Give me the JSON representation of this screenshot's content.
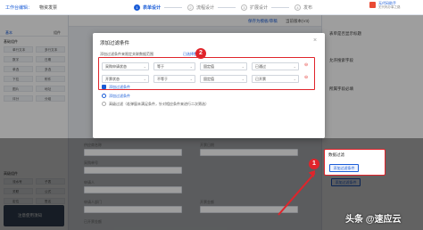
{
  "topbar": {
    "back_label": "工作台编辑：",
    "app_name": "物资发票",
    "steps": [
      {
        "num": "1",
        "label": "表单设计",
        "active": true
      },
      {
        "num": "2",
        "label": "流程设计",
        "active": false
      },
      {
        "num": "3",
        "label": "扩展设计",
        "active": false
      },
      {
        "num": "4",
        "label": "发布",
        "active": false
      }
    ],
    "user_name": "无代码助手",
    "user_sub": "无代码办事之路",
    "save_label": "保存",
    "next_label": "下一步",
    "sub_link": "保存为模板/草稿",
    "version_label": "当前版本(V3)"
  },
  "sidebar": {
    "tabs": [
      "基本",
      "",
      "组件"
    ],
    "groups": [
      {
        "title": "基础组件",
        "items": [
          "单行文本",
          "多行文本",
          "数字",
          "日期",
          "单选",
          "多选",
          "下拉",
          "附件",
          "图片",
          "地址",
          "评分",
          "分组"
        ]
      },
      {
        "title": "高级组件",
        "items": [
          "流水号",
          "子表",
          "关联",
          "公式",
          "定位",
          "签名"
        ]
      }
    ],
    "banner": "注意使用须知"
  },
  "right_panel": {
    "items": [
      "表单是否显示标题",
      "允许搜索字段",
      "所属字段必填",
      "数据过滤",
      "添加过滤条件"
    ],
    "filter_section_title": "数据过滤",
    "filter_button": "添加过滤条件",
    "colors": {
      "primary": "#1a5cd7",
      "danger": "#e53935"
    }
  },
  "dialog": {
    "title": "添加过滤条件",
    "hint": "添加过滤条件来限定关联数据范围",
    "link_text": "已选择数据表",
    "rows": [
      {
        "field": "采购申请状态",
        "op": "等于",
        "kind": "固定值",
        "value": "已通过"
      },
      {
        "field": "开票状态",
        "op": "不等于",
        "kind": "固定值",
        "value": "已开票"
      }
    ],
    "add_condition": "添加过滤条件",
    "option1_label": "添加过滤条件",
    "option2_label": "高级过滤（若弹窗未满足条件，针对相应条件来进行二次筛选）"
  },
  "form": {
    "labels": [
      "供应商编号",
      "供应商名称",
      "开票日期",
      "采购单号",
      "申请人",
      "申请人部门",
      "开票金额",
      "已开票金额"
    ],
    "badges": {
      "one": "1",
      "two": "2"
    }
  },
  "watermark": "头条 @速应云"
}
